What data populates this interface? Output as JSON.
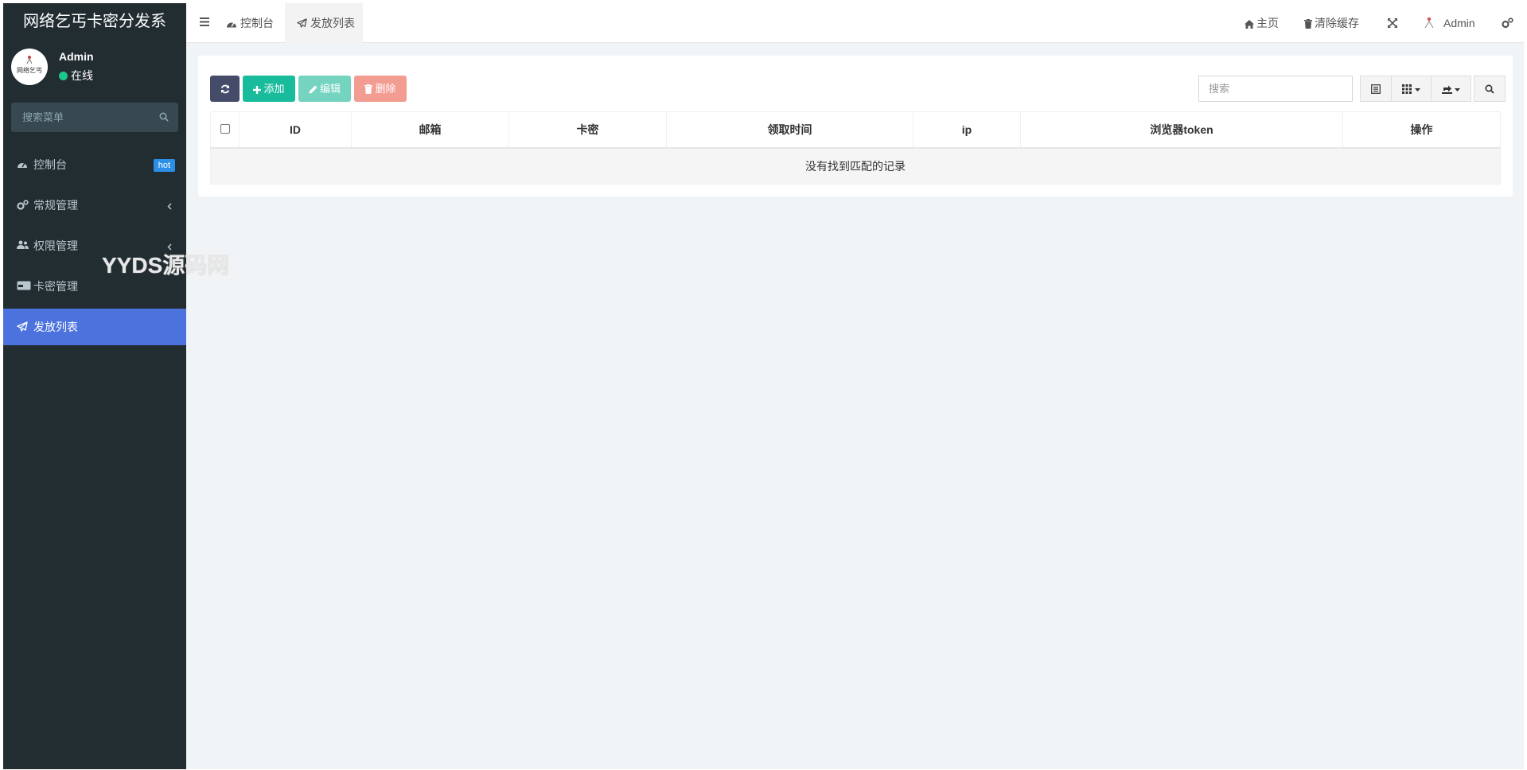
{
  "sidebar": {
    "logo": "网络乞丐卡密分发系",
    "avatar_text": "网络乞丐",
    "user": {
      "name": "Admin",
      "status": "在线"
    },
    "search_placeholder": "搜索菜单",
    "items": [
      {
        "label": "控制台",
        "badge": "hot"
      },
      {
        "label": "常规管理"
      },
      {
        "label": "权限管理"
      },
      {
        "label": "卡密管理"
      },
      {
        "label": "发放列表"
      }
    ],
    "watermark": "YYDS源码网"
  },
  "header": {
    "tabs": [
      {
        "label": "控制台"
      },
      {
        "label": "发放列表"
      }
    ],
    "home": "主页",
    "clear_cache": "清除缓存",
    "user": "Admin"
  },
  "toolbar": {
    "add": "添加",
    "edit": "编辑",
    "delete": "删除",
    "search_placeholder": "搜索"
  },
  "table": {
    "columns": [
      "ID",
      "邮箱",
      "卡密",
      "领取时间",
      "ip",
      "浏览器token",
      "操作"
    ],
    "empty_text": "没有找到匹配的记录"
  },
  "colors": {
    "sidebar_bg": "#222d32",
    "active_menu": "#4c72de",
    "refresh_btn": "#444c69",
    "add_btn": "#18bc9c",
    "edit_btn": "#74d4c0",
    "delete_btn": "#f39c92"
  }
}
